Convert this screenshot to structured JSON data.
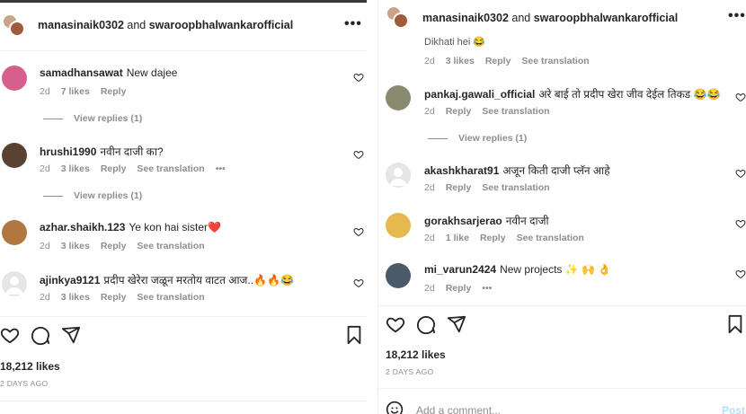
{
  "left": {
    "header": {
      "user1": "manasinaik0302",
      "joiner": " and ",
      "user2": "swaroopbhalwankarofficial",
      "more": "•••"
    },
    "comments": [
      {
        "user": "samadhansawat",
        "text": "New dajee",
        "time": "2d",
        "likes": "7 likes",
        "reply": "Reply",
        "avatar_color": "#d65f8d"
      },
      {
        "user": "hrushi1990",
        "text": "नवीन दाजी का?",
        "time": "2d",
        "likes": "3 likes",
        "reply": "Reply",
        "translate": "See translation",
        "more": "•••",
        "avatar_color": "#5a4232"
      },
      {
        "user": "azhar.shaikh.123",
        "text": "Ye kon hai sister❤️",
        "time": "2d",
        "likes": "3 likes",
        "reply": "Reply",
        "translate": "See translation",
        "avatar_color": "#b07840"
      },
      {
        "user": "ajinkya9121",
        "text": "प्रदीप खेरेरा जळून मरतोय वाटत आज..🔥🔥😂",
        "time": "2d",
        "likes": "3 likes",
        "reply": "Reply",
        "translate": "See translation",
        "avatar_color": "#e0e0e0"
      }
    ],
    "replies_1": "View replies (1)",
    "replies_2": "View replies (1)",
    "likes": "18,212 likes",
    "ago": "2 DAYS AGO"
  },
  "right": {
    "header": {
      "user1": "manasinaik0302",
      "joiner": " and ",
      "user2": "swaroopbhalwankarofficial",
      "more": "•••"
    },
    "partial": {
      "text": "Dikhati hei 😂",
      "time": "2d",
      "likes": "3 likes",
      "reply": "Reply",
      "translate": "See translation"
    },
    "comments": [
      {
        "user": "pankaj.gawali_official",
        "text": "अरे बाई तो प्रदीप खेरा जीव देईल तिकड 😂😂",
        "time": "2d",
        "reply": "Reply",
        "translate": "See translation",
        "avatar_color": "#8a8a70"
      },
      {
        "user": "akashkharat91",
        "text": "अजून किती दाजी प्लॅन आहे",
        "time": "2d",
        "reply": "Reply",
        "translate": "See translation",
        "avatar_color": "#e0e0e0"
      },
      {
        "user": "gorakhsarjerao",
        "text": "नवीन दाजी",
        "time": "2d",
        "likes": "1 like",
        "reply": "Reply",
        "translate": "See translation",
        "avatar_color": "#e8b850"
      },
      {
        "user": "mi_varun2424",
        "text": "New projects ✨ 🙌 👌",
        "time": "2d",
        "reply": "Reply",
        "more": "•••",
        "avatar_color": "#4a5a6a"
      }
    ],
    "replies_1": "View replies (1)",
    "likes": "18,212 likes",
    "ago": "2 DAYS AGO",
    "add_comment_placeholder": "Add a comment...",
    "post": "Post"
  }
}
